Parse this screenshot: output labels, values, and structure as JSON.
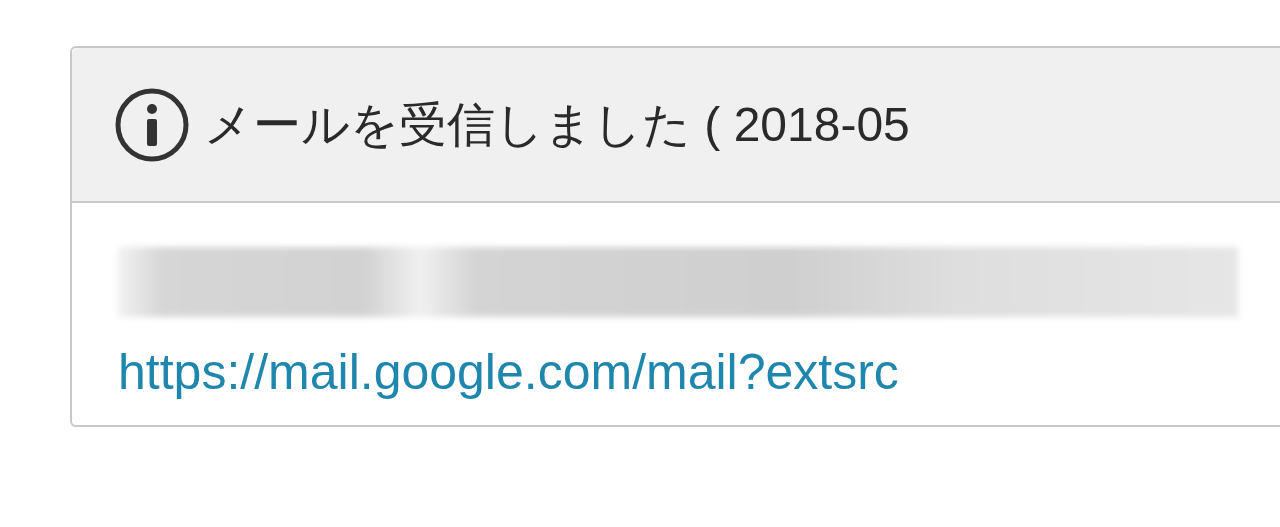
{
  "notification": {
    "title": "メールを受信しました ( 2018-05",
    "link": "https://mail.google.com/mail?extsrc"
  }
}
